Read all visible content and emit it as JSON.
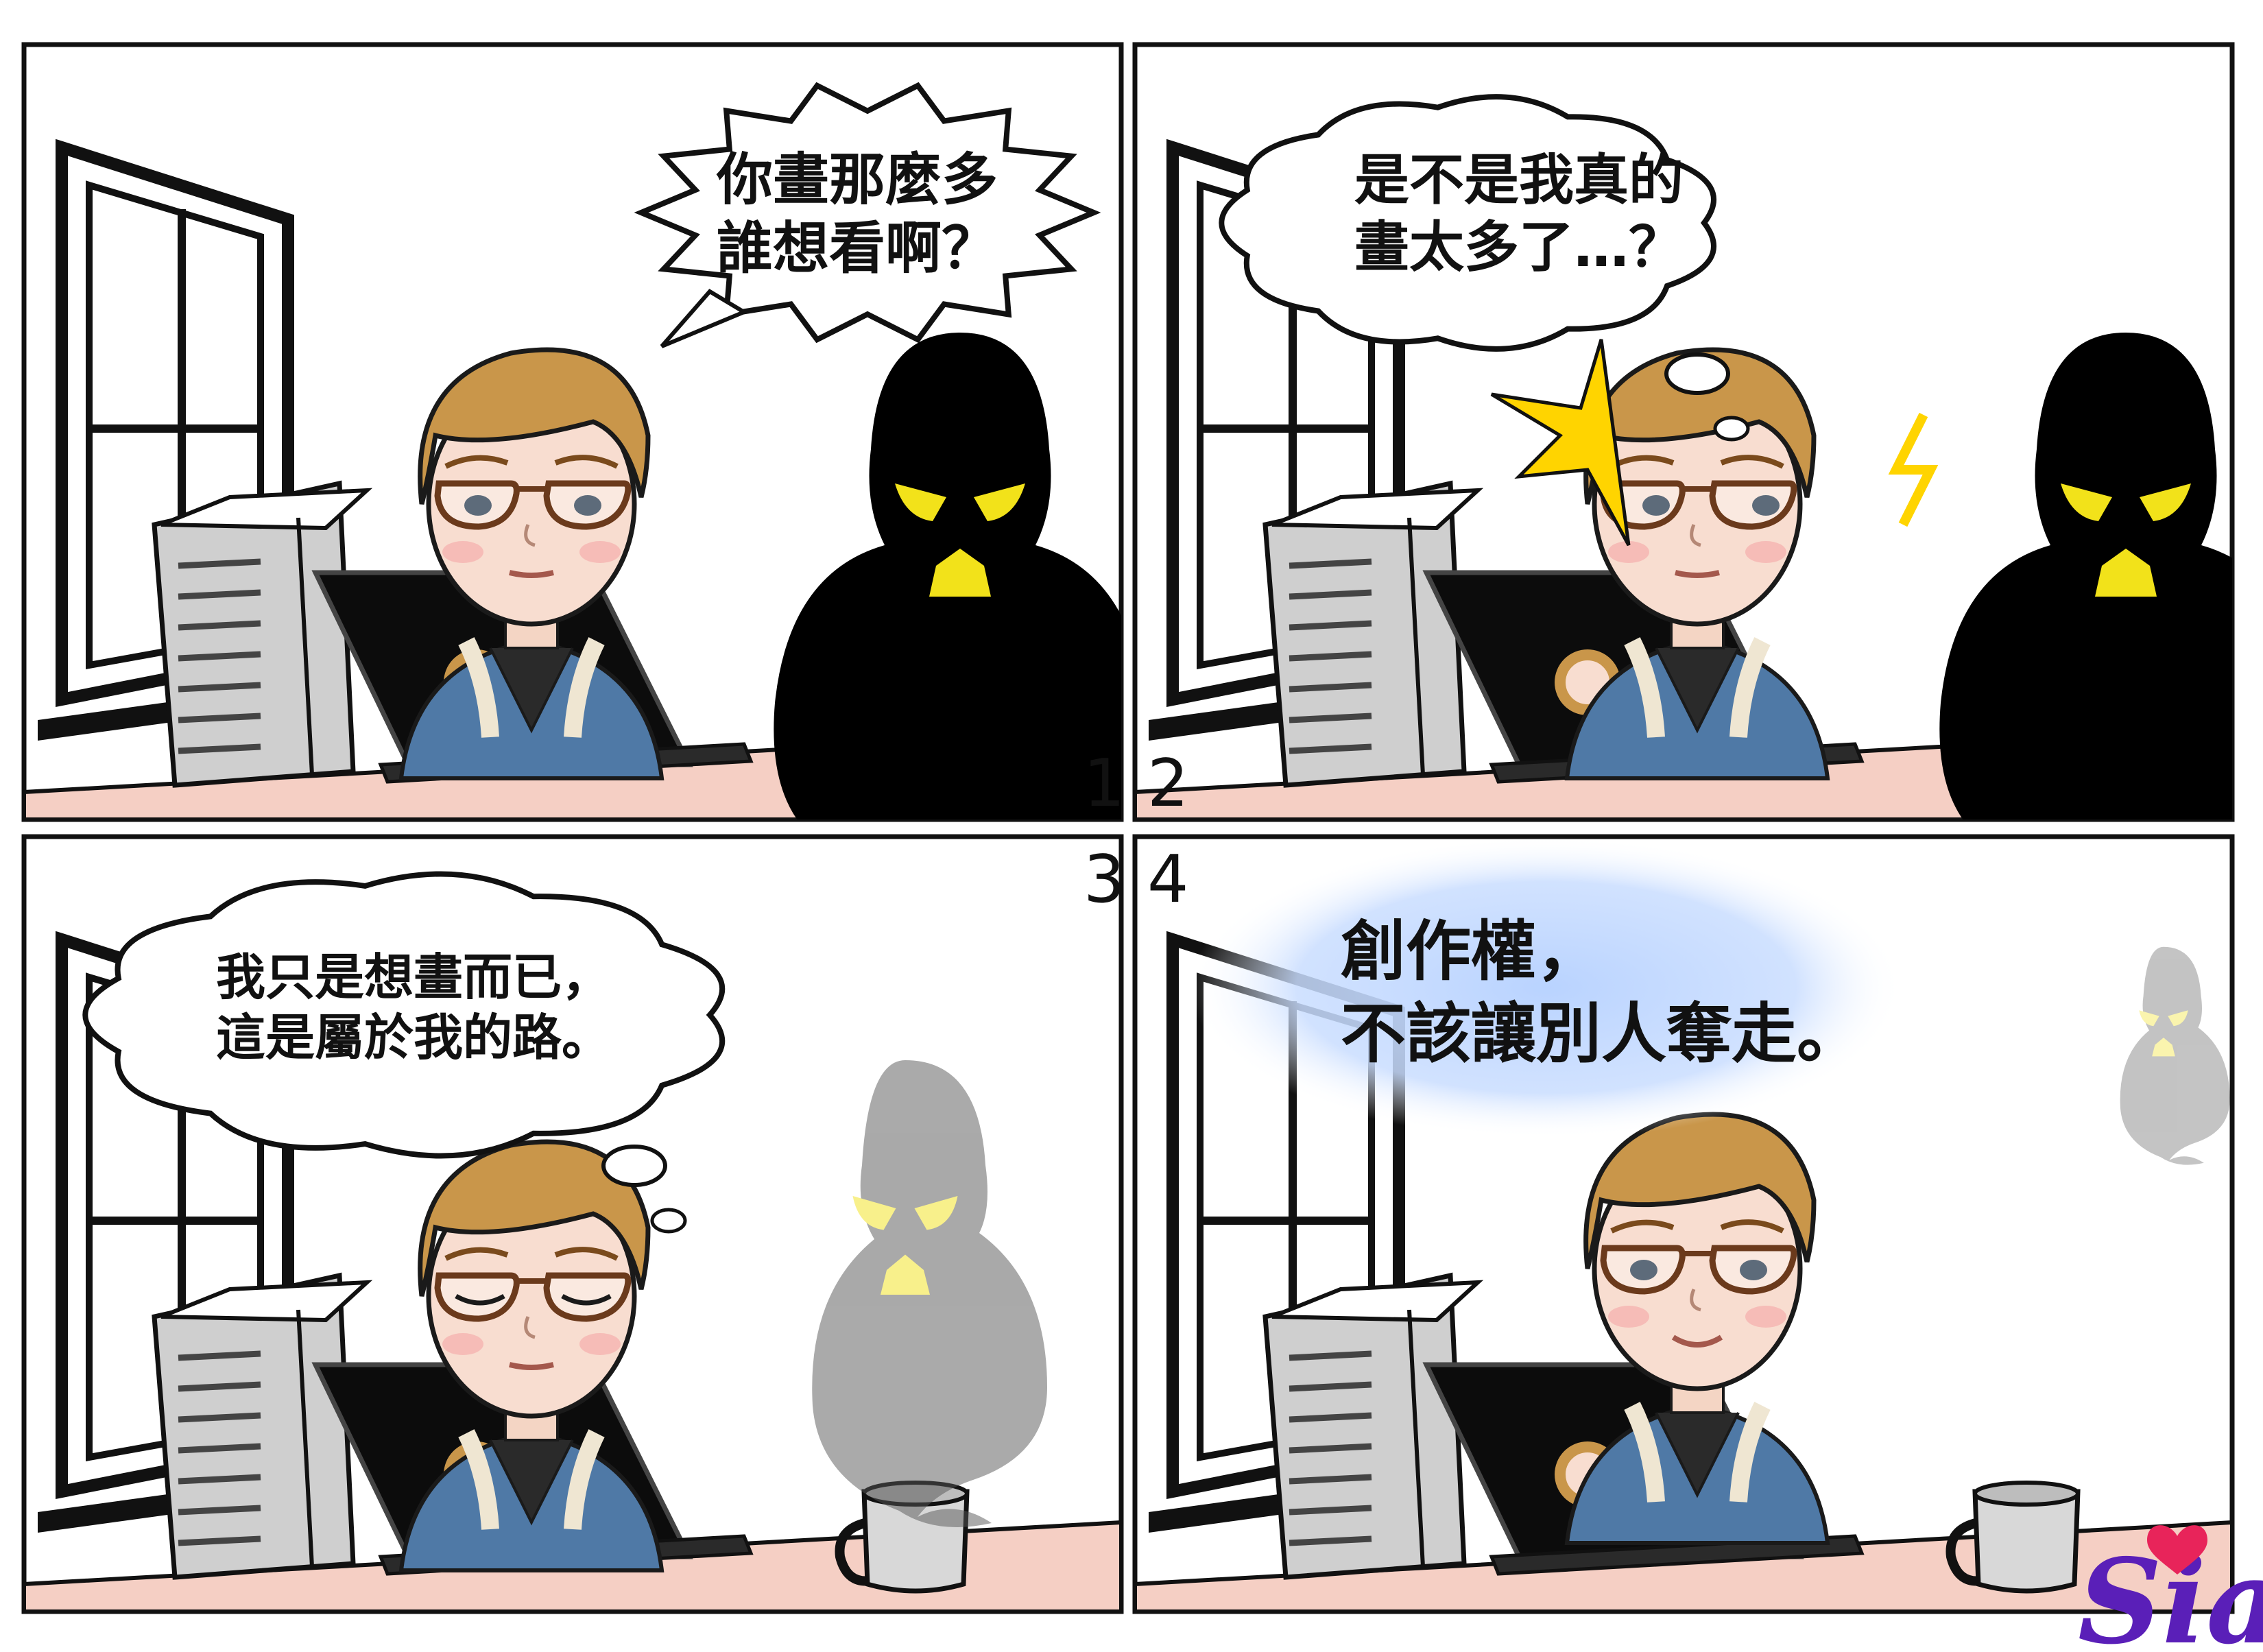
{
  "comic": {
    "panels": [
      {
        "number": "1",
        "bubble_type": "shout",
        "lines": [
          "你畫那麼多",
          "誰想看啊？"
        ],
        "shadow_opacity": 1
      },
      {
        "number": "2",
        "bubble_type": "thought",
        "lines": [
          "是不是我真的",
          "畫太多了…？"
        ],
        "shadow_opacity": 1
      },
      {
        "number": "3",
        "bubble_type": "thought",
        "lines": [
          "我只是想畫而已，",
          "這是屬於我的路。"
        ],
        "shadow_opacity": 0.5
      },
      {
        "number": "4",
        "bubble_type": "narration",
        "lines": [
          "創作權，",
          "不該讓別人奪走。"
        ],
        "shadow_opacity": 0.35
      }
    ],
    "signature": "Sian",
    "colors": {
      "table": "#f5cfc4",
      "shadow_figure": "#000000",
      "shadow_eyes": "#f2e21a",
      "hair": "#c9964a",
      "jacket": "#4f79a6",
      "laptop": "#0c0c0c",
      "mug": "#d8d8d8",
      "narration_glow": "#b9d3ff",
      "signature": "#5a1fb8",
      "surprise_burst": "#ffd400"
    },
    "icons": [
      "window-icon",
      "paper-stack-icon",
      "laptop-icon",
      "mug-icon",
      "shadow-figure-icon",
      "person-icon",
      "heart-icon"
    ]
  }
}
